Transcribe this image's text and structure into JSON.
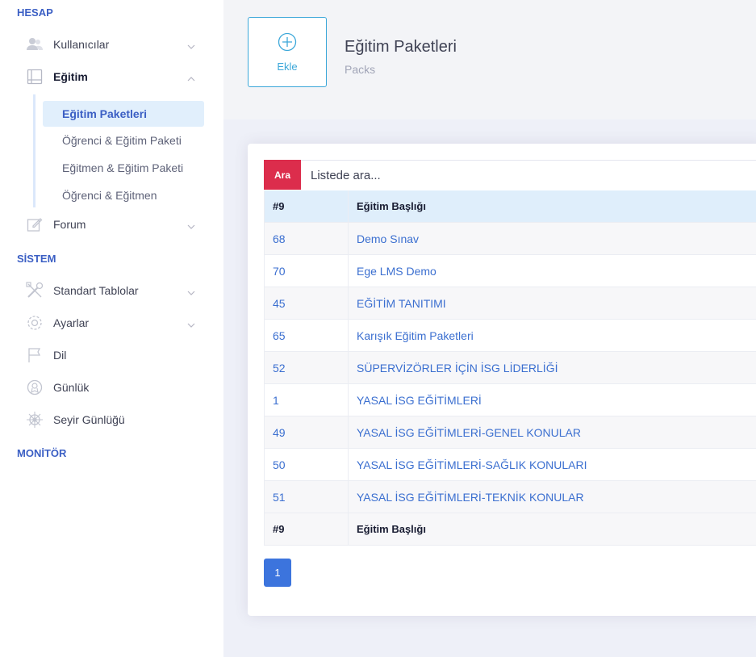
{
  "sidebar": {
    "sections": {
      "account": "HESAP",
      "system": "SİSTEM",
      "monitor": "MONİTÖR"
    },
    "items": {
      "users": "Kullanıcılar",
      "education": "Eğitim",
      "forum": "Forum",
      "standard_tables": "Standart Tablolar",
      "settings": "Ayarlar",
      "language": "Dil",
      "log": "Günlük",
      "trip_log": "Seyir Günlüğü"
    },
    "submenu": [
      "Eğitim Paketleri",
      "Öğrenci & Eğitim Paketi",
      "Eğitmen & Eğitim Paketi",
      "Öğrenci & Eğitmen"
    ]
  },
  "header": {
    "add_label": "Ekle",
    "title": "Eğitim Paketleri",
    "subtitle": "Packs"
  },
  "search": {
    "button": "Ara",
    "placeholder": "Listede ara..."
  },
  "table": {
    "header": [
      "#9",
      "Eğitim Başlığı"
    ],
    "rows": [
      [
        "68",
        "Demo Sınav"
      ],
      [
        "70",
        "Ege LMS Demo"
      ],
      [
        "45",
        "EĞİTİM TANITIMI"
      ],
      [
        "65",
        "Karışık Eğitim Paketleri"
      ],
      [
        "52",
        "SÜPERVİZÖRLER İÇİN İSG LİDERLİĞİ"
      ],
      [
        "1",
        "YASAL İSG EĞİTİMLERİ"
      ],
      [
        "49",
        "YASAL İSG EĞİTİMLERİ-GENEL KONULAR"
      ],
      [
        "50",
        "YASAL İSG EĞİTİMLERİ-SAĞLIK KONULARI"
      ],
      [
        "51",
        "YASAL İSG EĞİTİMLERİ-TEKNİK KONULAR"
      ]
    ],
    "footer": [
      "#9",
      "Eğitim Başlığı"
    ]
  },
  "pagination": {
    "current": "1"
  },
  "colors": {
    "accent": "#3b5fc4",
    "danger": "#dc2d4c",
    "link": "#3b6fd0",
    "active_bg": "#e1effc"
  }
}
